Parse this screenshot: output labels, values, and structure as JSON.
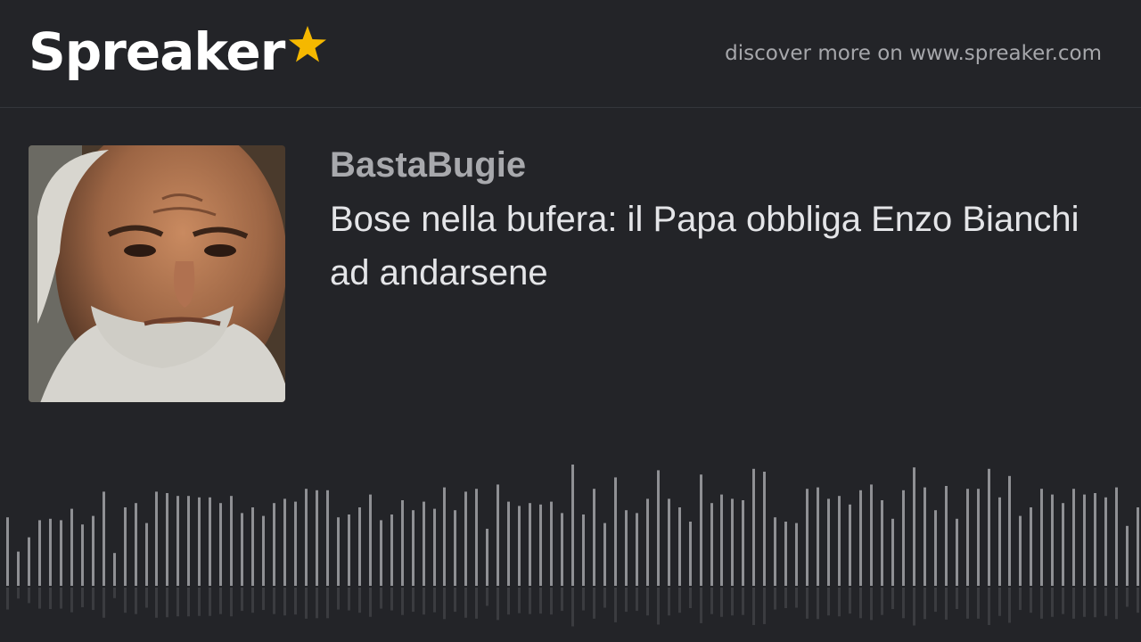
{
  "brand": {
    "name": "Spreaker",
    "star_color": "#f5b800",
    "discover_text": "discover more on www.spreaker.com"
  },
  "podcast": {
    "show_name": "BastaBugie",
    "episode_title": "Bose nella bufera: il Papa obbliga Enzo Bianchi ad andarsene",
    "cover_alt": "portrait-photo"
  },
  "waveform": {
    "color": "#8f9094",
    "reflection_color": "#3b3c40",
    "levels": [
      0.48,
      0.24,
      0.34,
      0.46,
      0.47,
      0.46,
      0.54,
      0.43,
      0.49,
      0.66,
      0.23,
      0.55,
      0.58,
      0.44,
      0.66,
      0.65,
      0.63,
      0.63,
      0.62,
      0.62,
      0.58,
      0.63,
      0.51,
      0.55,
      0.49,
      0.58,
      0.61,
      0.59,
      0.68,
      0.67,
      0.67,
      0.48,
      0.5,
      0.55,
      0.64,
      0.46,
      0.5,
      0.6,
      0.53,
      0.59,
      0.54,
      0.69,
      0.53,
      0.66,
      0.68,
      0.4,
      0.71,
      0.59,
      0.56,
      0.58,
      0.57,
      0.59,
      0.51,
      0.85,
      0.5,
      0.68,
      0.44,
      0.76,
      0.53,
      0.51,
      0.61,
      0.81,
      0.61,
      0.55,
      0.45,
      0.78,
      0.58,
      0.64,
      0.61,
      0.6,
      0.82,
      0.8,
      0.48,
      0.45,
      0.44,
      0.68,
      0.69,
      0.61,
      0.63,
      0.57,
      0.67,
      0.71,
      0.6,
      0.47,
      0.67,
      0.83,
      0.69,
      0.53,
      0.7,
      0.47,
      0.68,
      0.68,
      0.82,
      0.62,
      0.77,
      0.49,
      0.55,
      0.68,
      0.64,
      0.58,
      0.68,
      0.64,
      0.65,
      0.62,
      0.69,
      0.42,
      0.55
    ]
  }
}
